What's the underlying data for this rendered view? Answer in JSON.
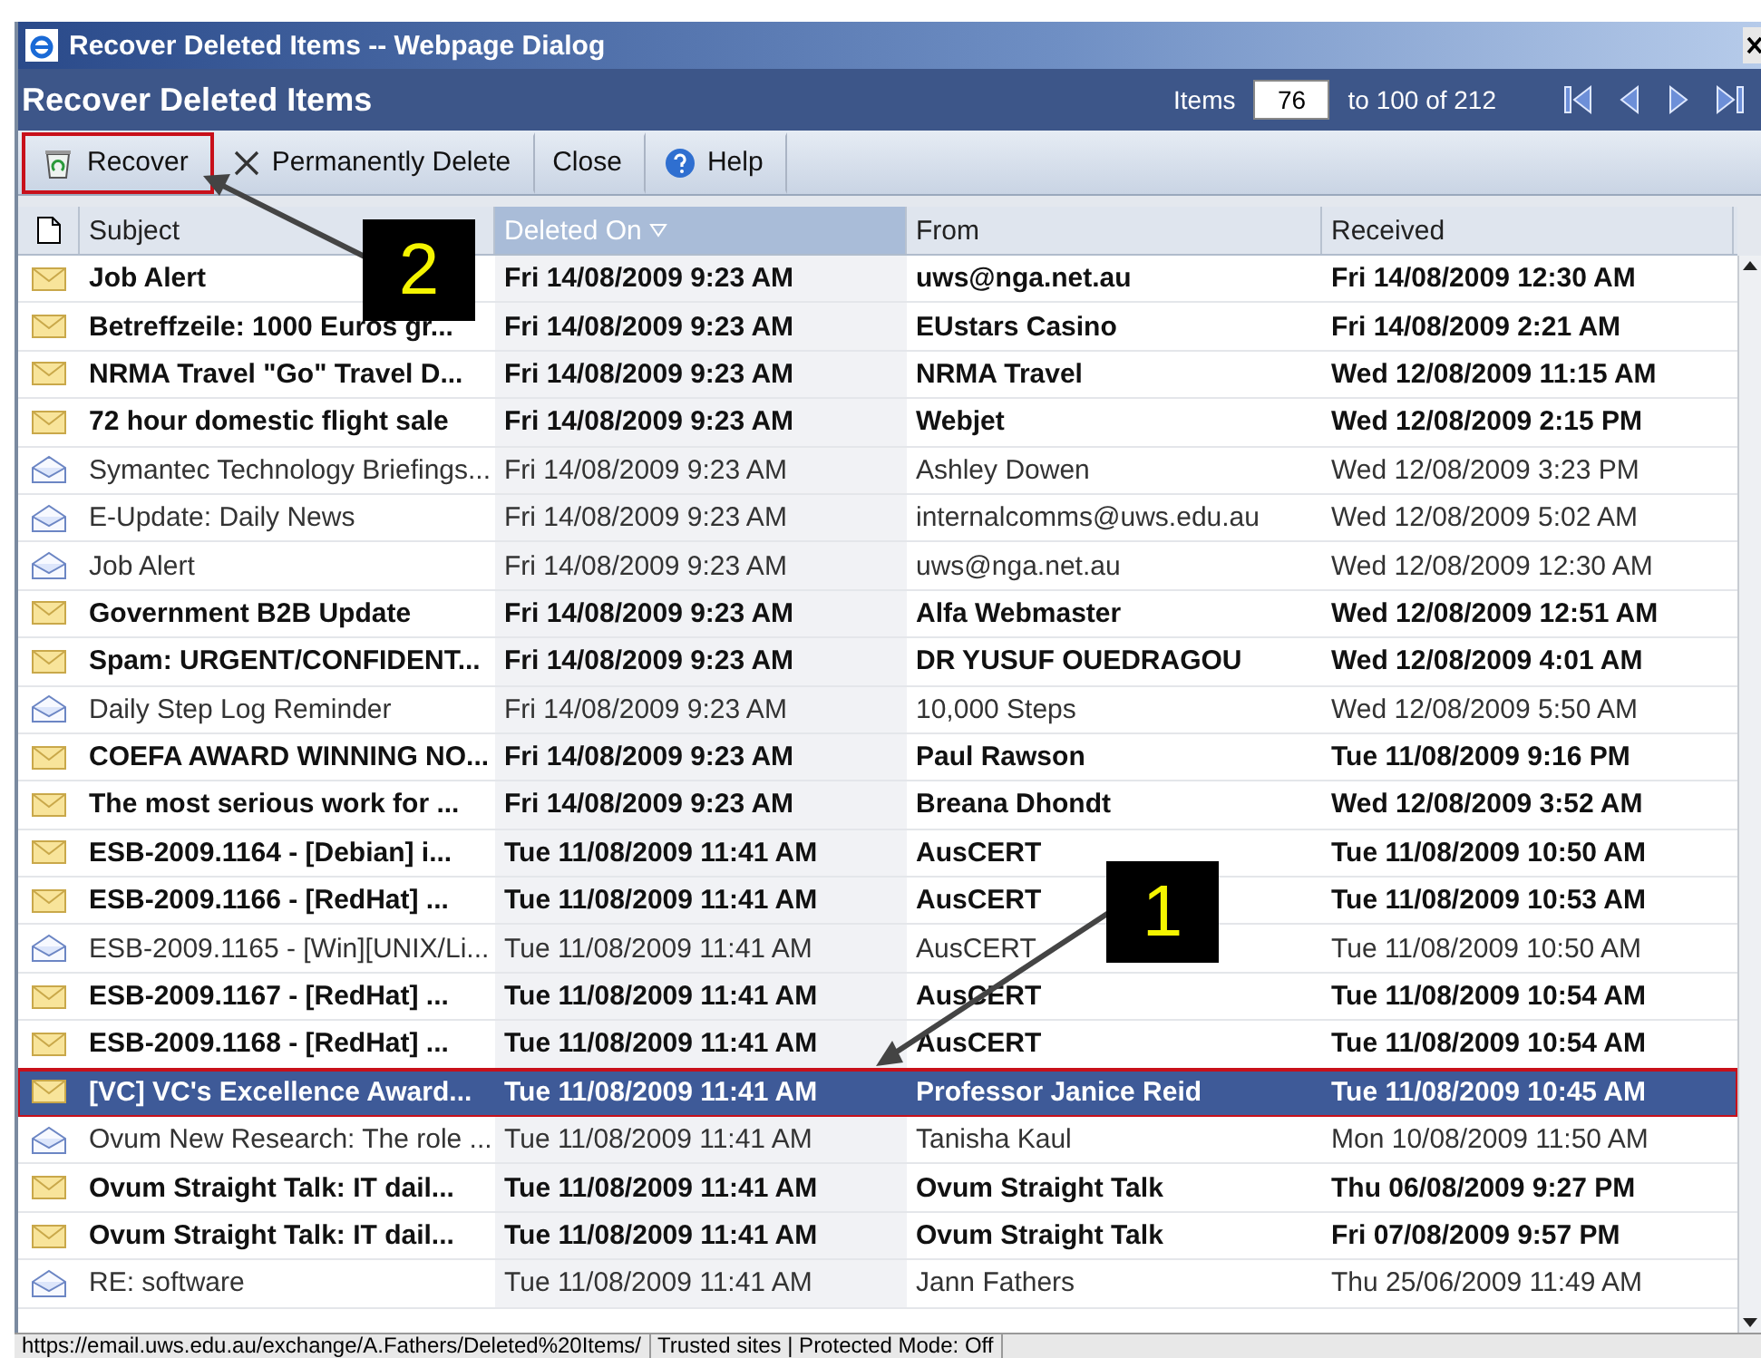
{
  "window": {
    "title": "Recover Deleted Items -- Webpage Dialog"
  },
  "header": {
    "title": "Recover Deleted Items",
    "items_label": "Items",
    "page_field": "76",
    "range": "to 100 of 212"
  },
  "toolbar": [
    {
      "kind": "recover",
      "label": "Recover",
      "highlighted": true
    },
    {
      "kind": "delete",
      "label": "Permanently Delete",
      "highlighted": false
    },
    {
      "kind": "plain",
      "label": "Close",
      "highlighted": false
    },
    {
      "kind": "help",
      "label": "Help",
      "highlighted": false
    }
  ],
  "table": {
    "columns": [
      {
        "label": "Subject",
        "sorted": false
      },
      {
        "label": "Deleted On",
        "sorted": true
      },
      {
        "label": "From",
        "sorted": false
      },
      {
        "label": "Received",
        "sorted": false
      }
    ],
    "rows": [
      {
        "subject": "Job Alert",
        "deleted_on": "Fri 14/08/2009 9:23 AM",
        "from": "uws@nga.net.au",
        "received": "Fri 14/08/2009 12:30 AM",
        "unread": true,
        "selected": false
      },
      {
        "subject": "Betreffzeile: 1000 Euros gr...",
        "deleted_on": "Fri 14/08/2009 9:23 AM",
        "from": "EUstars Casino",
        "received": "Fri 14/08/2009 2:21 AM",
        "unread": true,
        "selected": false
      },
      {
        "subject": "NRMA Travel \"Go\" Travel D...",
        "deleted_on": "Fri 14/08/2009 9:23 AM",
        "from": "NRMA Travel",
        "received": "Wed 12/08/2009 11:15 AM",
        "unread": true,
        "selected": false
      },
      {
        "subject": "72 hour domestic flight sale",
        "deleted_on": "Fri 14/08/2009 9:23 AM",
        "from": "Webjet",
        "received": "Wed 12/08/2009 2:15 PM",
        "unread": true,
        "selected": false
      },
      {
        "subject": "Symantec Technology Briefings...",
        "deleted_on": "Fri 14/08/2009 9:23 AM",
        "from": "Ashley Dowen",
        "received": "Wed 12/08/2009 3:23 PM",
        "unread": false,
        "selected": false
      },
      {
        "subject": "E-Update: Daily News",
        "deleted_on": "Fri 14/08/2009 9:23 AM",
        "from": "internalcomms@uws.edu.au",
        "received": "Wed 12/08/2009 5:02 AM",
        "unread": false,
        "selected": false
      },
      {
        "subject": "Job Alert",
        "deleted_on": "Fri 14/08/2009 9:23 AM",
        "from": "uws@nga.net.au",
        "received": "Wed 12/08/2009 12:30 AM",
        "unread": false,
        "selected": false
      },
      {
        "subject": "Government B2B Update",
        "deleted_on": "Fri 14/08/2009 9:23 AM",
        "from": "Alfa Webmaster",
        "received": "Wed 12/08/2009 12:51 AM",
        "unread": true,
        "selected": false
      },
      {
        "subject": "Spam: URGENT/CONFIDENT...",
        "deleted_on": "Fri 14/08/2009 9:23 AM",
        "from": "DR YUSUF OUEDRAGOU",
        "received": "Wed 12/08/2009 4:01 AM",
        "unread": true,
        "selected": false
      },
      {
        "subject": "Daily Step Log Reminder",
        "deleted_on": "Fri 14/08/2009 9:23 AM",
        "from": "10,000 Steps",
        "received": "Wed 12/08/2009 5:50 AM",
        "unread": false,
        "selected": false
      },
      {
        "subject": "COEFA AWARD WINNING NO...",
        "deleted_on": "Fri 14/08/2009 9:23 AM",
        "from": "Paul Rawson",
        "received": "Tue 11/08/2009 9:16 PM",
        "unread": true,
        "selected": false
      },
      {
        "subject": "The most serious work for ...",
        "deleted_on": "Fri 14/08/2009 9:23 AM",
        "from": "Breana Dhondt",
        "received": "Wed 12/08/2009 3:52 AM",
        "unread": true,
        "selected": false
      },
      {
        "subject": "ESB-2009.1164 - [Debian] i...",
        "deleted_on": "Tue 11/08/2009 11:41 AM",
        "from": "AusCERT",
        "received": "Tue 11/08/2009 10:50 AM",
        "unread": true,
        "selected": false
      },
      {
        "subject": "ESB-2009.1166 - [RedHat] ...",
        "deleted_on": "Tue 11/08/2009 11:41 AM",
        "from": "AusCERT",
        "received": "Tue 11/08/2009 10:53 AM",
        "unread": true,
        "selected": false
      },
      {
        "subject": "ESB-2009.1165 - [Win][UNIX/Li...",
        "deleted_on": "Tue 11/08/2009 11:41 AM",
        "from": "AusCERT",
        "received": "Tue 11/08/2009 10:50 AM",
        "unread": false,
        "selected": false
      },
      {
        "subject": "ESB-2009.1167 - [RedHat] ...",
        "deleted_on": "Tue 11/08/2009 11:41 AM",
        "from": "AusCERT",
        "received": "Tue 11/08/2009 10:54 AM",
        "unread": true,
        "selected": false
      },
      {
        "subject": "ESB-2009.1168 - [RedHat] ...",
        "deleted_on": "Tue 11/08/2009 11:41 AM",
        "from": "AusCERT",
        "received": "Tue 11/08/2009 10:54 AM",
        "unread": true,
        "selected": false
      },
      {
        "subject": "[VC] VC's Excellence Award...",
        "deleted_on": "Tue 11/08/2009 11:41 AM",
        "from": "Professor Janice Reid",
        "received": "Tue 11/08/2009 10:45 AM",
        "unread": true,
        "selected": true
      },
      {
        "subject": "Ovum New Research: The role ...",
        "deleted_on": "Tue 11/08/2009 11:41 AM",
        "from": "Tanisha Kaul",
        "received": "Mon 10/08/2009 11:50 AM",
        "unread": false,
        "selected": false
      },
      {
        "subject": "Ovum Straight Talk: IT dail...",
        "deleted_on": "Tue 11/08/2009 11:41 AM",
        "from": "Ovum Straight Talk",
        "received": "Thu 06/08/2009 9:27 PM",
        "unread": true,
        "selected": false
      },
      {
        "subject": "Ovum Straight Talk: IT dail...",
        "deleted_on": "Tue 11/08/2009 11:41 AM",
        "from": "Ovum Straight Talk",
        "received": "Fri 07/08/2009 9:57 PM",
        "unread": true,
        "selected": false
      },
      {
        "subject": "RE: software",
        "deleted_on": "Tue 11/08/2009 11:41 AM",
        "from": "Jann Fathers",
        "received": "Thu 25/06/2009 11:49 AM",
        "unread": false,
        "selected": false
      }
    ]
  },
  "status_bar": {
    "url": "https://email.uws.edu.au/exchange/A.Fathers/Deleted%20Items/",
    "zone": "Trusted sites | Protected Mode: Off"
  },
  "callouts": [
    {
      "label": "1"
    },
    {
      "label": "2"
    }
  ]
}
